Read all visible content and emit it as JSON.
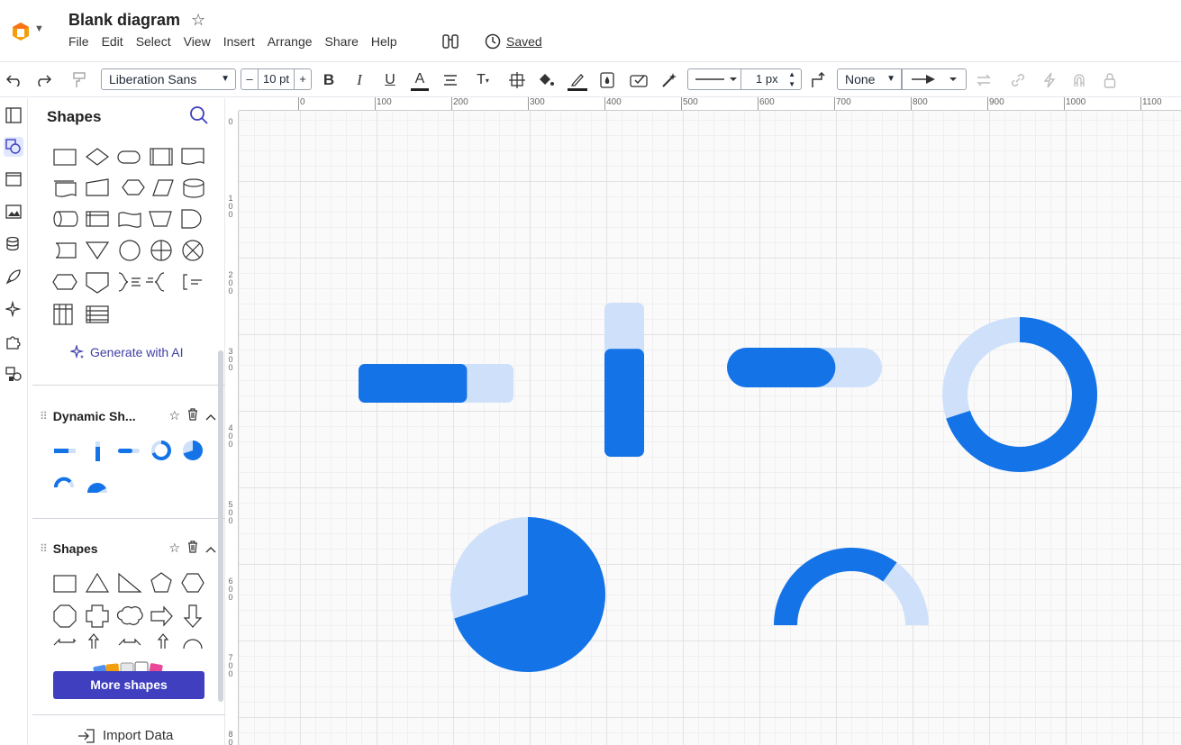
{
  "app": {
    "title": "Blank diagram",
    "saved_label": "Saved",
    "menu": [
      "File",
      "Edit",
      "Select",
      "View",
      "Insert",
      "Arrange",
      "Share",
      "Help"
    ]
  },
  "toolbar": {
    "font": "Liberation Sans",
    "font_size": "10 pt",
    "size_minus": "–",
    "size_plus": "+",
    "bold": "B",
    "italic": "I",
    "underline": "U",
    "text_color": "A",
    "line_width": "1 px",
    "line_start": "None"
  },
  "panel": {
    "title": "Shapes",
    "generate_ai": "Generate with AI",
    "sections": [
      {
        "name": "Dynamic Sh..."
      },
      {
        "name": "Shapes"
      }
    ],
    "more_shapes": "More shapes",
    "import_data": "Import Data"
  },
  "ruler": {
    "top_labels": [
      "0",
      "100",
      "200",
      "300",
      "400",
      "500",
      "600",
      "700",
      "800",
      "900",
      "1000",
      "1100"
    ],
    "left_labels": [
      "0",
      "100",
      "200",
      "300",
      "400",
      "500",
      "600",
      "700",
      "800"
    ]
  },
  "canvas": {
    "colors": {
      "primary": "#1473e6",
      "light": "#cfe1fa"
    },
    "progress_bar": {
      "value": 0.7
    },
    "vertical_bar": {
      "value": 0.7
    },
    "pill_bar": {
      "value": 0.7
    },
    "ring": {
      "value": 0.7
    },
    "pie": {
      "value": 0.7
    },
    "gauge": {
      "value": 0.7
    }
  }
}
